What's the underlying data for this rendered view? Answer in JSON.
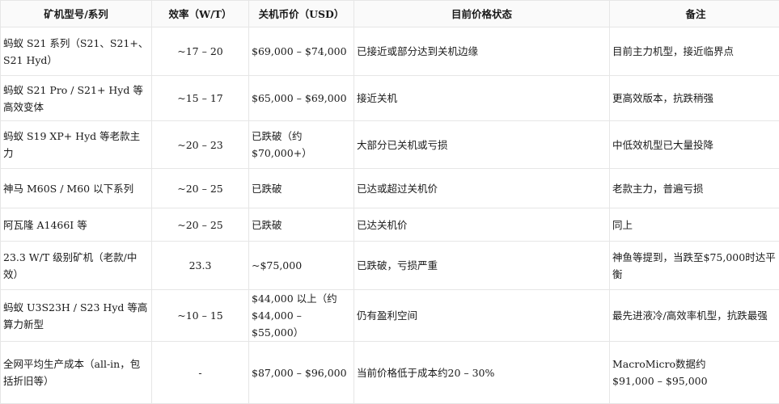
{
  "headers": [
    "矿机型号/系列",
    "效率（W/T）",
    "关机币价（USD）",
    "目前价格状态",
    "备注"
  ],
  "rows": [
    {
      "model": "蚂蚁 S21 系列（S21、S21+、S21 Hyd）",
      "efficiency": "~17 – 20",
      "shutdown_price": "$69,000 – $74,000",
      "status": "已接近或部分达到关机边缘",
      "note": "目前主力机型，接近临界点",
      "note2": ""
    },
    {
      "model": "蚂蚁 S21 Pro / S21+ Hyd 等高效变体",
      "efficiency": "~15 – 17",
      "shutdown_price": "$65,000 – $69,000",
      "status": "接近关机",
      "note": "更高效版本，抗跌稍强",
      "note2": ""
    },
    {
      "model": "蚂蚁 S19 XP+ Hyd 等老款主力",
      "efficiency": "~20 – 23",
      "shutdown_price": "已跌破（约 $70,000+）",
      "status": "大部分已关机或亏损",
      "note": "中低效机型已大量投降",
      "note2": ""
    },
    {
      "model": "神马 M60S / M60 以下系列",
      "efficiency": "~20 – 25",
      "shutdown_price": "已跌破",
      "status": "已达或超过关机价",
      "note": "老款主力，普遍亏损",
      "note2": ""
    },
    {
      "model": "阿瓦隆 A1466I 等",
      "efficiency": "~20 – 25",
      "shutdown_price": "已跌破",
      "status": "已达关机价",
      "note": "同上",
      "note2": ""
    },
    {
      "model": "23.3 W/T 级别矿机（老款/中效）",
      "efficiency": "23.3",
      "shutdown_price": "~$75,000",
      "status": "已跌破，亏损严重",
      "note": "神鱼等提到，当跌至$75,000时达平衡",
      "note2": ""
    },
    {
      "model": "蚂蚁 U3S23H / S23 Hyd 等高算力新型",
      "efficiency": "~10 – 15",
      "shutdown_price": "$44,000 以上（约 $44,000 – $55,000）",
      "status": "仍有盈利空间",
      "note": "最先进液冷/高效率机型，抗跌最强",
      "note2": ""
    },
    {
      "model": "全网平均生产成本（all-in，包括折旧等）",
      "efficiency": "-",
      "shutdown_price": "$87,000 – $96,000",
      "status": "当前价格低于成本约20 – 30%",
      "note": "MacroMicro数据约",
      "note2": "$91,000 – $95,000"
    }
  ]
}
